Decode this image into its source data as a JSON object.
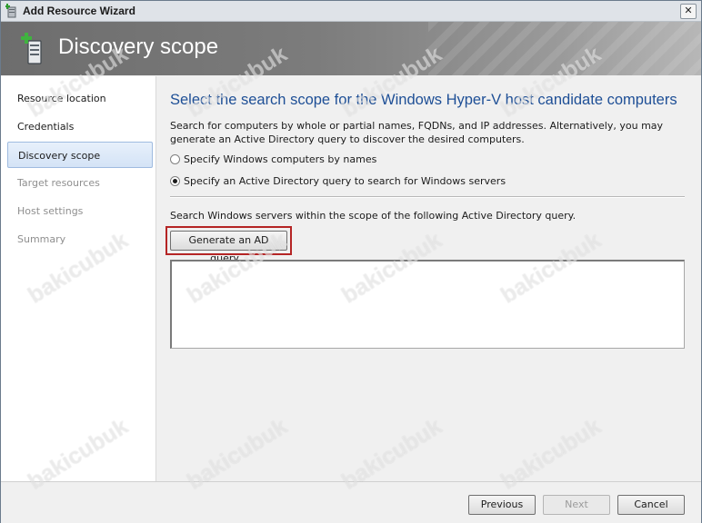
{
  "window": {
    "title": "Add Resource Wizard",
    "close_label": "✕"
  },
  "banner": {
    "heading": "Discovery scope"
  },
  "sidebar": {
    "items": [
      {
        "label": "Resource location",
        "state": "normal"
      },
      {
        "label": "Credentials",
        "state": "normal"
      },
      {
        "label": "Discovery scope",
        "state": "selected"
      },
      {
        "label": "Target resources",
        "state": "disabled"
      },
      {
        "label": "Host settings",
        "state": "disabled"
      },
      {
        "label": "Summary",
        "state": "disabled"
      }
    ]
  },
  "main": {
    "title": "Select the search scope for the Windows Hyper-V host candidate computers",
    "description": "Search for computers by whole or partial names, FQDNs, and IP addresses. Alternatively, you may generate an Active Directory query to discover the desired computers.",
    "options": [
      {
        "label": "Specify Windows computers by names",
        "checked": false
      },
      {
        "label": "Specify an Active Directory query to search for Windows servers",
        "checked": true
      }
    ],
    "scope_text": "Search Windows servers within the scope of the following Active Directory query.",
    "generate_button": "Generate an AD query...",
    "query_value": ""
  },
  "footer": {
    "previous": "Previous",
    "next": "Next",
    "cancel": "Cancel"
  },
  "watermark": {
    "text": "bakicubuk"
  },
  "colors": {
    "title_blue": "#1e4f96",
    "highlight_red": "#b52525",
    "selected_bg": "#d4e3f6"
  }
}
